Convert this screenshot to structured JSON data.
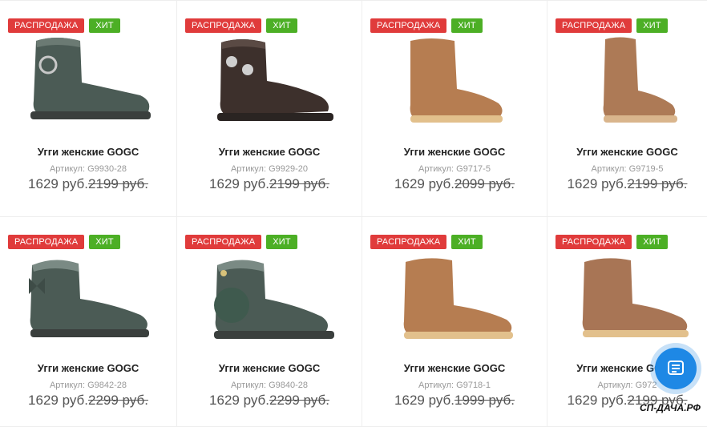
{
  "products": [
    {
      "title": "Угги женские GOGC",
      "sku": "Артикул: G9930-28",
      "price": "1629 руб.",
      "old_price": "2199 руб.",
      "badges": {
        "sale": "РАСПРОДАЖА",
        "hit": "ХИТ"
      },
      "color": "#4b5b55"
    },
    {
      "title": "Угги женские GOGC",
      "sku": "Артикул: G9929-20",
      "price": "1629 руб.",
      "old_price": "2199 руб.",
      "badges": {
        "sale": "РАСПРОДАЖА",
        "hit": "ХИТ"
      },
      "color": "#3d302c"
    },
    {
      "title": "Угги женские GOGC",
      "sku": "Артикул: G9717-5",
      "price": "1629 руб.",
      "old_price": "2099 руб.",
      "badges": {
        "sale": "РАСПРОДАЖА",
        "hit": "ХИТ"
      },
      "color": "#b67d51"
    },
    {
      "title": "Угги женские GOGC",
      "sku": "Артикул: G9719-5",
      "price": "1629 руб.",
      "old_price": "2199 руб.",
      "badges": {
        "sale": "РАСПРОДАЖА",
        "hit": "ХИТ"
      },
      "color": "#ad7a56"
    },
    {
      "title": "Угги женские GOGC",
      "sku": "Артикул: G9842-28",
      "price": "1629 руб.",
      "old_price": "2299 руб.",
      "badges": {
        "sale": "РАСПРОДАЖА",
        "hit": "ХИТ"
      },
      "color": "#4b5b55"
    },
    {
      "title": "Угги женские GOGC",
      "sku": "Артикул: G9840-28",
      "price": "1629 руб.",
      "old_price": "2299 руб.",
      "badges": {
        "sale": "РАСПРОДАЖА",
        "hit": "ХИТ"
      },
      "color": "#4b5b55"
    },
    {
      "title": "Угги женские GOGC",
      "sku": "Артикул: G9718-1",
      "price": "1629 руб.",
      "old_price": "1999 руб.",
      "badges": {
        "sale": "РАСПРОДАЖА",
        "hit": "ХИТ"
      },
      "color": "#b67d51"
    },
    {
      "title": "Угги женские GOGC",
      "sku": "Артикул: G972",
      "price": "1629 руб.",
      "old_price": "2199 руб.",
      "badges": {
        "sale": "РАСПРОДАЖА",
        "hit": "ХИТ"
      },
      "color": "#a87555"
    }
  ],
  "watermark": "СП-ДАЧА.РФ",
  "chat_icon": "chat-icon",
  "colors": {
    "sale_badge": "#e03b3b",
    "hit_badge": "#4caf25",
    "chat_button": "#1e88e5"
  }
}
